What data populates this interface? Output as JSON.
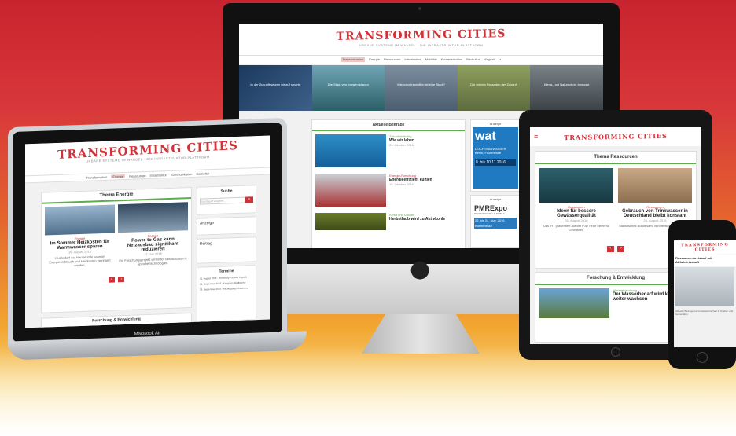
{
  "brand": {
    "logo": "TRANSFORMING CITIES",
    "tagline": "URBANE SYSTEME IM WANDEL · DIE INFRASTRUKTUR-PLATTFORM",
    "accent": "#d13238",
    "green": "#5cae4c"
  },
  "imac": {
    "nav": [
      "Transformation",
      "Energie",
      "Ressourcen",
      "Infrastruktur",
      "Mobilität",
      "Kommunikation",
      "Baukultur",
      "Magazin"
    ],
    "search_icon": "search-icon",
    "hero": [
      "In der Zukunft setzen wir auf smarte",
      "Die Stadt von morgen planen",
      "Wie naturfreundlich ist eine Stadt?",
      "Die grünen Fassaden der Zukunft",
      "Klima- und Naturschutz bewusst"
    ],
    "section_title": "Aktuelle Beiträge",
    "articles": [
      {
        "kicker": "Zukunftsträchtig",
        "title": "Wie wir leben",
        "date": "20. Oktober 2016"
      },
      {
        "kicker": "Energie-Forschung",
        "title": "Energieeffizient kühlen",
        "date": "19. Oktober 2016"
      },
      {
        "kicker": "Klima und Umwelt",
        "title": "Herbstlaub wird zu Aktivkohle",
        "date": ""
      }
    ],
    "ad_label": "Anzeige",
    "ad1": {
      "name": "wat",
      "line1": "LEICHTBAUWASSER",
      "line2": "Berlin, Fachmesse",
      "line3": "8. bis 10.11.2016"
    },
    "ad2_label": "Anzeige",
    "ad2": {
      "name": "PMRExpo",
      "line1": "PROFESSIONELLE MOBILE",
      "line2": "22. bis 24. Nov. 2016",
      "line3": "Koelnmesse"
    }
  },
  "macbook": {
    "label": "MacBook Air",
    "nav": [
      "Transformation",
      "Energie",
      "Ressourcen",
      "Infrastruktur",
      "Kommunikation",
      "Baukultur"
    ],
    "section_title": "Thema Energie",
    "cards": [
      {
        "kicker": "Energie",
        "title": "Im Sommer Heizkosten für Warmwasser sparen",
        "date": "16. August 2016",
        "text": "Heizbedarf der Heizperiode kann im Energieverbrauch und Heizkosten verringert werden."
      },
      {
        "kicker": "Energie",
        "title": "Power-to-Gas kann Netzausbau signifikant reduzieren",
        "date": "12. Juli 2016",
        "text": "Ein Forschungsprojekt verbindet Netzausbau mit Speichertechnologien."
      }
    ],
    "pages": [
      "‹",
      "›"
    ],
    "search_title": "Suche",
    "search_placeholder": "Suchbegriff eingeben ...",
    "newsletter_title": "Anzeige",
    "login_title": "Beitrag",
    "events_title": "Termine",
    "events": [
      "11. August 2016 · Workshop: Urbane Logistik",
      "21. September 2016 · Kongress Stadtwerke",
      "26. September 2016 · Fachtagung Infrastruktur"
    ],
    "section2_title": "Forschung & Entwicklung"
  },
  "ipad": {
    "section_title": "Thema Ressourcen",
    "cards": [
      {
        "kicker": "Ressourcen",
        "title": "Ideen für bessere Gewässerqualität",
        "date": "31. August 2016",
        "text": "Das IHT präsentiert auf der IFAT neue Ideen für Gewässer."
      },
      {
        "kicker": "Ressourcen",
        "title": "Gebrauch von Trinkwasser in Deutschland bleibt konstant",
        "date": "25. August 2016",
        "text": "Statistisches Bundesamt veröffentlicht neue Zahlen."
      }
    ],
    "pages": [
      "‹",
      "›"
    ],
    "section2_title": "Forschung & Entwicklung",
    "feature": {
      "kicker": "Wasserforschung",
      "title": "Der Wasserbedarf wird künftig weiter wachsen"
    }
  },
  "iphone": {
    "headline": "Ressourcenkreislauf mit Abfallwirtschaft",
    "text": "Aktuelle Beiträge zur Kreislaufwirtschaft in Städten und Gemeinden."
  }
}
